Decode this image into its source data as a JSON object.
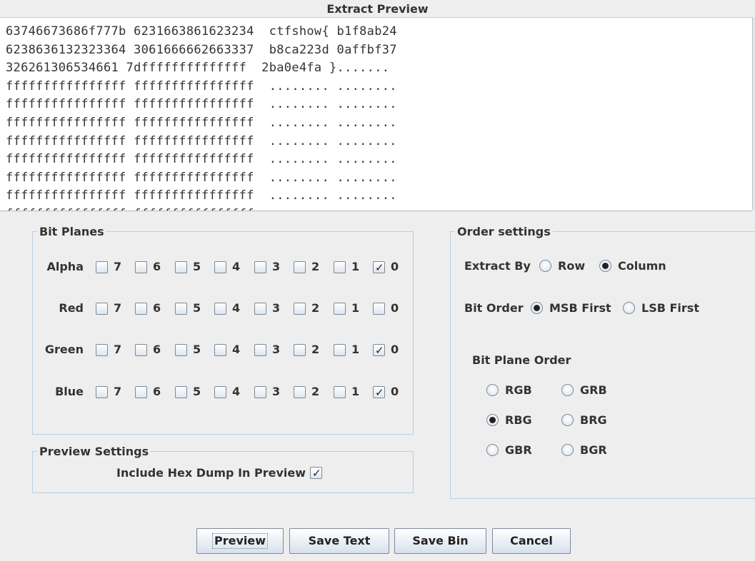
{
  "dialog": {
    "title": "Extract Preview"
  },
  "preview": {
    "lines": [
      "63746673686f777b 6231663861623234  ctfshow{ b1f8ab24",
      "6238636132323364 3061666662663337  b8ca223d 0affbf37",
      "326261306534661 7dffffffffffffff  2ba0e4fa }.......",
      "ffffffffffffffff ffffffffffffffff  ........ ........",
      "ffffffffffffffff ffffffffffffffff  ........ ........",
      "ffffffffffffffff ffffffffffffffff  ........ ........",
      "ffffffffffffffff ffffffffffffffff  ........ ........",
      "ffffffffffffffff ffffffffffffffff  ........ ........",
      "ffffffffffffffff ffffffffffffffff  ........ ........",
      "ffffffffffffffff ffffffffffffffff  ........ ........",
      "ffffffffffffffff ffffffffffffffff  ........ ........"
    ]
  },
  "bit_planes": {
    "title": "Bit Planes",
    "rows": [
      {
        "label": "Alpha",
        "bits": [
          "7",
          "6",
          "5",
          "4",
          "3",
          "2",
          "1",
          "0"
        ],
        "checked": [
          false,
          false,
          false,
          false,
          false,
          false,
          false,
          true
        ]
      },
      {
        "label": "Red",
        "bits": [
          "7",
          "6",
          "5",
          "4",
          "3",
          "2",
          "1",
          "0"
        ],
        "checked": [
          false,
          false,
          false,
          false,
          false,
          false,
          false,
          false
        ]
      },
      {
        "label": "Green",
        "bits": [
          "7",
          "6",
          "5",
          "4",
          "3",
          "2",
          "1",
          "0"
        ],
        "checked": [
          false,
          false,
          false,
          false,
          false,
          false,
          false,
          true
        ]
      },
      {
        "label": "Blue",
        "bits": [
          "7",
          "6",
          "5",
          "4",
          "3",
          "2",
          "1",
          "0"
        ],
        "checked": [
          false,
          false,
          false,
          false,
          false,
          false,
          false,
          true
        ]
      }
    ],
    "check_glyph": "✓"
  },
  "preview_settings": {
    "title": "Preview Settings",
    "include_hex_label": "Include Hex Dump In Preview",
    "include_hex_checked": true
  },
  "order_settings": {
    "title": "Order settings",
    "extract_by": {
      "label": "Extract By",
      "options": [
        "Row",
        "Column"
      ],
      "selected": "Column"
    },
    "bit_order": {
      "label": "Bit Order",
      "options": [
        "MSB First",
        "LSB First"
      ],
      "selected": "MSB First"
    },
    "bit_plane_order": {
      "label": "Bit Plane Order",
      "options": [
        "RGB",
        "GRB",
        "RBG",
        "BRG",
        "GBR",
        "BGR"
      ],
      "selected": "RBG"
    }
  },
  "buttons": {
    "preview": "Preview",
    "save_text": "Save Text",
    "save_bin": "Save Bin",
    "cancel": "Cancel"
  }
}
